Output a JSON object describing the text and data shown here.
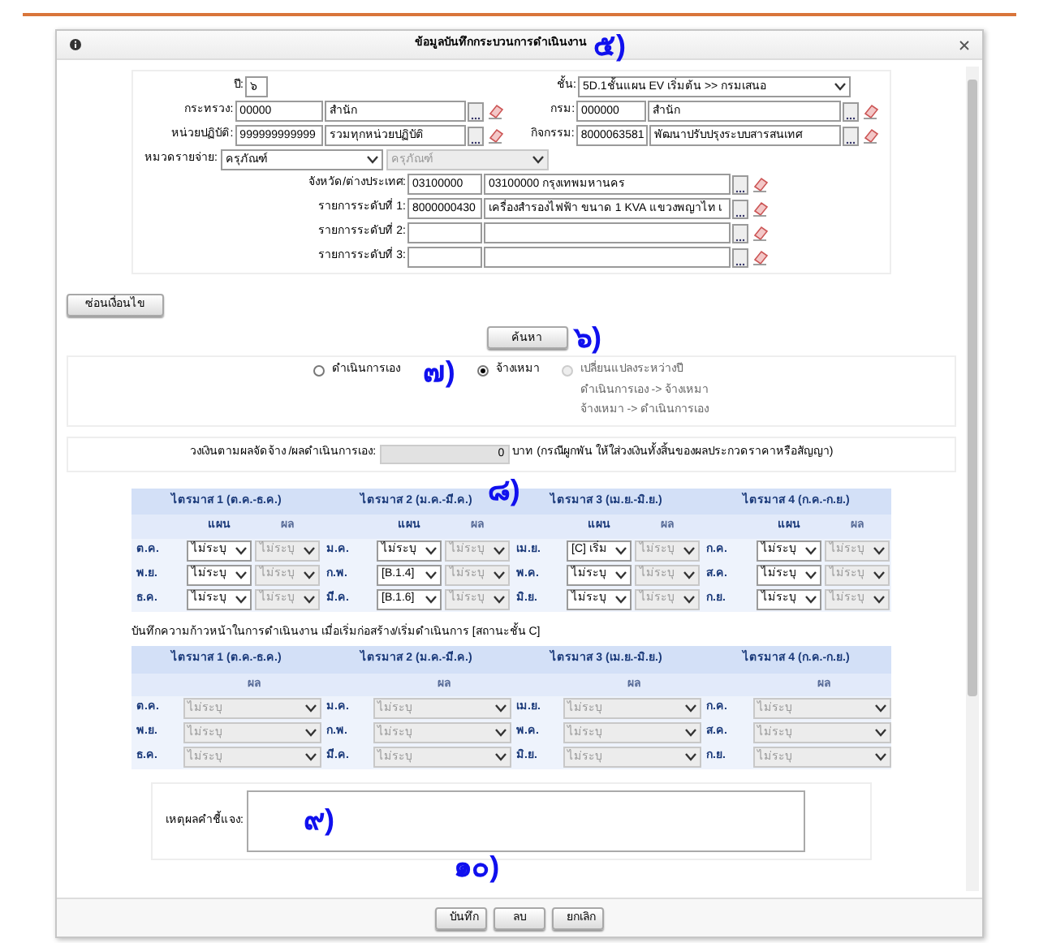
{
  "dialog": {
    "title": "ข้อมูลบันทึกกระบวนการดำเนินงาน",
    "annotation": "๕)"
  },
  "filters": {
    "year": {
      "label": "ปี:",
      "value": "๖"
    },
    "level": {
      "label": "ชั้น:",
      "value": "5D.1ชั้นแผน EV เริ่มต้น >> กรมเสนอ"
    },
    "left": [
      {
        "label": "กระทรวง:",
        "code": "00000",
        "name": "สำนัก"
      },
      {
        "label": "หน่วยปฏิบัติ:",
        "code": "999999999999",
        "name": "รวมทุกหน่วยปฏิบัติ"
      }
    ],
    "right": [
      {
        "label": "กรม:",
        "code": "000000",
        "name": "สำนัก"
      },
      {
        "label": "กิจกรรม:",
        "code": "8000063581",
        "name": "พัฒนาปรับปรุงระบบสารสนเทศ"
      }
    ],
    "expense": {
      "label": "หมวดรายจ่าย:",
      "selects": [
        {
          "value": "ครุภัณฑ์",
          "disabled": false
        },
        {
          "value": "ครุภัณฑ์",
          "disabled": true
        }
      ]
    },
    "center": [
      {
        "label": "จังหวัด/ต่างประเทศ:",
        "code": "03100000",
        "name": "03100000 กรุงเทพมหานคร"
      },
      {
        "label": "รายการระดับที่ 1:",
        "code": "8000000430",
        "name": "เครื่องสำรองไฟฟ้า ขนาด 1 KVA แขวงพญาไท เ"
      },
      {
        "label": "รายการระดับที่ 2:"
      },
      {
        "label": "รายการระดับที่ 3:"
      }
    ]
  },
  "hide_button": "ซ่อนเงื่อนไข",
  "search_button": {
    "label": "ค้นหา",
    "annotation": "๖)"
  },
  "method": {
    "annotation": "๗)",
    "options": [
      {
        "label": "ดำเนินการเอง",
        "selected": false,
        "disabled": false
      },
      {
        "label": "จ้างเหมา",
        "selected": true,
        "disabled": false
      },
      {
        "label": "เปลี่ยนแปลงระหว่างปี",
        "selected": false,
        "disabled": true,
        "notes": [
          "ดำเนินการเอง -> จ้างเหมา",
          "จ้างเหมา -> ดำเนินการเอง"
        ]
      }
    ]
  },
  "budget": {
    "label": "วงเงินตามผลจัดจ้าง /ผลดำเนินการเอง:",
    "value": "0",
    "note": "บาท (กรณีผูกพัน ให้ใส่วงเงินทั้งสิ้นของผลประกวดราคาหรือสัญญา)"
  },
  "plan_table": {
    "annotation": "๘)",
    "quarters": [
      {
        "title": "ไตรมาส 1 (ต.ค.-ธ.ค.)",
        "columns": [
          {
            "label": "แผน",
            "disabled": false
          },
          {
            "label": "ผล",
            "disabled": true
          }
        ],
        "months": [
          {
            "name": "ต.ค.",
            "values": [
              "ไม่ระบุ",
              "ไม่ระบุ"
            ]
          },
          {
            "name": "พ.ย.",
            "values": [
              "ไม่ระบุ",
              "ไม่ระบุ"
            ]
          },
          {
            "name": "ธ.ค.",
            "values": [
              "ไม่ระบุ",
              "ไม่ระบุ"
            ]
          }
        ]
      },
      {
        "title": "ไตรมาส 2 (ม.ค.-มี.ค.)",
        "columns": [
          {
            "label": "แผน",
            "disabled": false
          },
          {
            "label": "ผล",
            "disabled": true
          }
        ],
        "months": [
          {
            "name": "ม.ค.",
            "values": [
              "ไม่ระบุ",
              "ไม่ระบุ"
            ]
          },
          {
            "name": "ก.พ.",
            "values": [
              "[B.1.4]",
              "ไม่ระบุ"
            ]
          },
          {
            "name": "มี.ค.",
            "values": [
              "[B.1.6]",
              "ไม่ระบุ"
            ]
          }
        ]
      },
      {
        "title": "ไตรมาส 3 (เม.ย.-มิ.ย.)",
        "columns": [
          {
            "label": "แผน",
            "disabled": false
          },
          {
            "label": "ผล",
            "disabled": true
          }
        ],
        "months": [
          {
            "name": "เม.ย.",
            "values": [
              "[C] เริ่ม",
              "ไม่ระบุ"
            ]
          },
          {
            "name": "พ.ค.",
            "values": [
              "ไม่ระบุ",
              "ไม่ระบุ"
            ]
          },
          {
            "name": "มิ.ย.",
            "values": [
              "ไม่ระบุ",
              "ไม่ระบุ"
            ]
          }
        ]
      },
      {
        "title": "ไตรมาส 4 (ก.ค.-ก.ย.)",
        "columns": [
          {
            "label": "แผน",
            "disabled": false
          },
          {
            "label": "ผล",
            "disabled": true
          }
        ],
        "months": [
          {
            "name": "ก.ค.",
            "values": [
              "ไม่ระบุ",
              "ไม่ระบุ"
            ]
          },
          {
            "name": "ส.ค.",
            "values": [
              "ไม่ระบุ",
              "ไม่ระบุ"
            ]
          },
          {
            "name": "ก.ย.",
            "values": [
              "ไม่ระบุ",
              "ไม่ระบุ"
            ]
          }
        ]
      }
    ]
  },
  "progress_table": {
    "caption": "บันทึกความก้าวหน้าในการดำเนินงาน เมื่อเริ่มก่อสร้าง/เริ่มดำเนินการ [สถานะชั้น C]",
    "quarters": [
      {
        "title": "ไตรมาส 1 (ต.ค.-ธ.ค.)",
        "columns": [
          {
            "label": "ผล",
            "disabled": true
          }
        ],
        "months": [
          {
            "name": "ต.ค.",
            "values": [
              "ไม่ระบุ"
            ]
          },
          {
            "name": "พ.ย.",
            "values": [
              "ไม่ระบุ"
            ]
          },
          {
            "name": "ธ.ค.",
            "values": [
              "ไม่ระบุ"
            ]
          }
        ]
      },
      {
        "title": "ไตรมาส 2 (ม.ค.-มี.ค.)",
        "columns": [
          {
            "label": "ผล",
            "disabled": true
          }
        ],
        "months": [
          {
            "name": "ม.ค.",
            "values": [
              "ไม่ระบุ"
            ]
          },
          {
            "name": "ก.พ.",
            "values": [
              "ไม่ระบุ"
            ]
          },
          {
            "name": "มี.ค.",
            "values": [
              "ไม่ระบุ"
            ]
          }
        ]
      },
      {
        "title": "ไตรมาส 3 (เม.ย.-มิ.ย.)",
        "columns": [
          {
            "label": "ผล",
            "disabled": true
          }
        ],
        "months": [
          {
            "name": "เม.ย.",
            "values": [
              "ไม่ระบุ"
            ]
          },
          {
            "name": "พ.ค.",
            "values": [
              "ไม่ระบุ"
            ]
          },
          {
            "name": "มิ.ย.",
            "values": [
              "ไม่ระบุ"
            ]
          }
        ]
      },
      {
        "title": "ไตรมาส 4 (ก.ค.-ก.ย.)",
        "columns": [
          {
            "label": "ผล",
            "disabled": true
          }
        ],
        "months": [
          {
            "name": "ก.ค.",
            "values": [
              "ไม่ระบุ"
            ]
          },
          {
            "name": "ส.ค.",
            "values": [
              "ไม่ระบุ"
            ]
          },
          {
            "name": "ก.ย.",
            "values": [
              "ไม่ระบุ"
            ]
          }
        ]
      }
    ]
  },
  "reason": {
    "label": "เหตุผลคำชี้แจง:",
    "annotation": "๙)"
  },
  "footer": {
    "annotation": "๑๐)",
    "buttons": [
      "บันทึก",
      "ลบ",
      "ยกเลิก"
    ]
  }
}
